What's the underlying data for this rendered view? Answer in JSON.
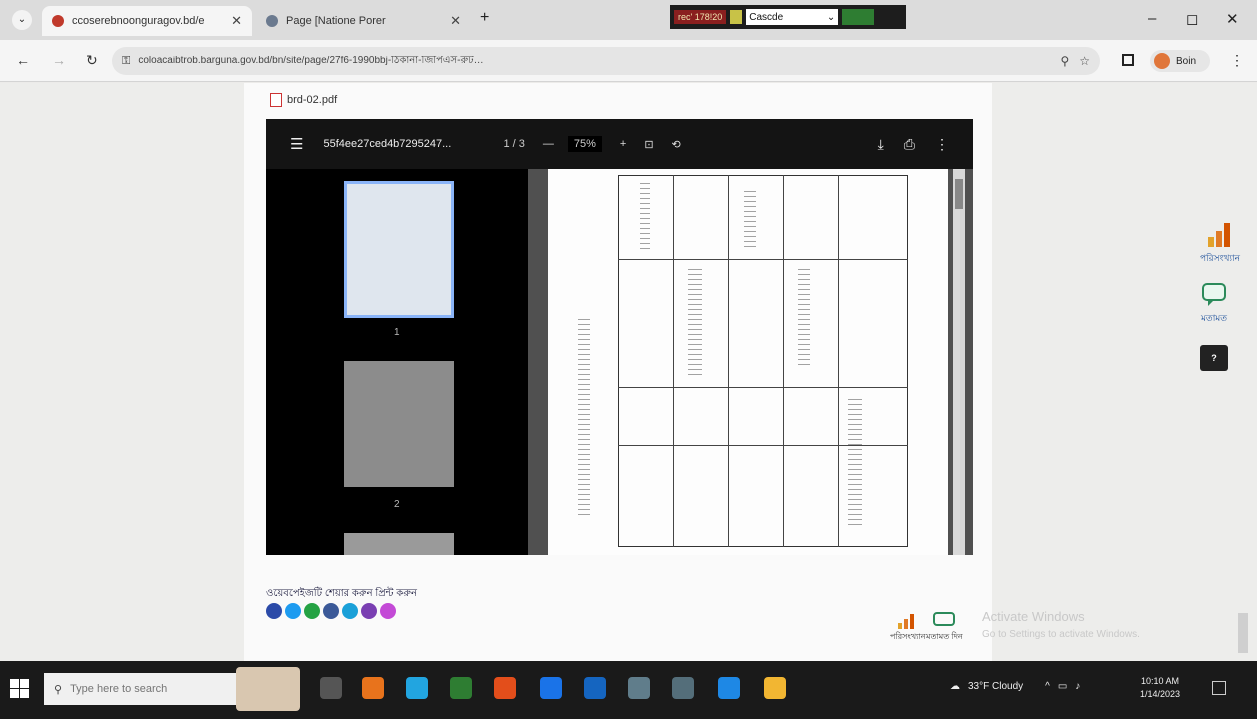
{
  "browser": {
    "tabs": [
      {
        "title": "ccoserebnoonguragov.bd/e",
        "favicon_color": "#c0392b",
        "active": true
      },
      {
        "title": "Page [Natione Porer",
        "favicon_color": "#6b7a8f",
        "active": false
      }
    ],
    "new_tab": "+",
    "window_controls": {
      "minimize": "–",
      "restore": "◻",
      "close": "✕"
    },
    "overlay": {
      "rec_label": "rec' 178!20",
      "select_value": "Cascde",
      "select_arrow": "⌄"
    },
    "address": {
      "url": "coloacaibtrob.barguna.gov.bd/bn/site/page/27f6-1990bbj-ঠিকানা-জিপিএস-রুট…"
    },
    "profile_label": "Boin"
  },
  "page": {
    "pdf_link": "brd-02.pdf",
    "viewer": {
      "file_name": "55f4ee27ced4b7295247...",
      "page_indicator": "1 / 3",
      "zoom": "75%",
      "thumb_numbers": [
        "1",
        "2"
      ]
    },
    "share_label": "ওয়েবপেইজটি শেয়ার করুন প্রিন্ট করুন",
    "share_colors": [
      "#2b4aa8",
      "#1d9bf0",
      "#25a244",
      "#3b5998",
      "#1aa0d8",
      "#7a3fb2",
      "#c34ad6"
    ],
    "mini_stat_label": "পরিসংখ্যান",
    "mini_feedback_label": "মতামত দিন",
    "watermark": {
      "line1": "Activate Windows",
      "line2": "Go to Settings to activate Windows."
    }
  },
  "floating": {
    "stats_label": "পরিসংখ্যান",
    "feedback_label": "মতামত",
    "help_glyph": "?"
  },
  "taskbar": {
    "search_placeholder": "Type here to search",
    "tray_weather": "33°F Cloudy",
    "time": "10:10 AM",
    "date": "1/14/2023",
    "app_colors": [
      "#1f6fb0",
      "#e8731c",
      "#22a5e0",
      "#2e7d32",
      "#e34e1b",
      "#1a73e8",
      "#1565c0",
      "#607d8b",
      "#546e7a",
      "#1e88e5",
      "#f2b632"
    ]
  }
}
